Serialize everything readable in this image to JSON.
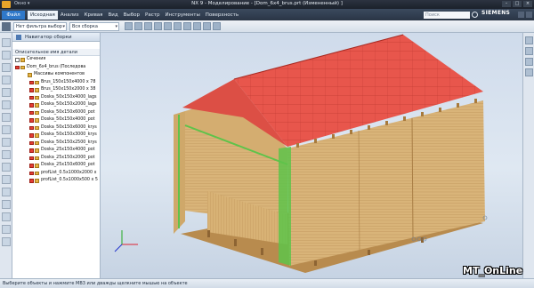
{
  "titlebar": {
    "title": "NX 9 - Моделирование - [Dom_6x4_brus.prt (Измененный) ]",
    "quick_access": "Окно ▾"
  },
  "ribbon": {
    "file_tab": "Файл",
    "tabs": [
      "Исходная",
      "Анализ",
      "Кривая",
      "Вид",
      "Выбор",
      "Растр",
      "Инструменты",
      "Поверхность"
    ],
    "active_tab": "Исходная",
    "search_placeholder": "Поиск",
    "brand": "SIEMENS"
  },
  "toolbar": {
    "filter_label": "Нет фильтра выбор",
    "scope_label": "Вся сборка"
  },
  "navigator": {
    "title": "Навигатор сборки",
    "column_header": "Описательное имя детали",
    "rows": [
      {
        "label": "Сечения",
        "indent": 1,
        "check": "empty"
      },
      {
        "label": "Dom_6x4_brus (Последова",
        "indent": 1,
        "check": "red"
      },
      {
        "label": "Массивы компонентов",
        "indent": 2,
        "check": "none"
      },
      {
        "label": "Brus_150x150x4000 x 78",
        "indent": 3,
        "check": "red"
      },
      {
        "label": "Brus_150x150x2000 x 38",
        "indent": 3,
        "check": "red"
      },
      {
        "label": "Doska_50x150x4000_lags",
        "indent": 3,
        "check": "red"
      },
      {
        "label": "Doska_50x150x2000_lags",
        "indent": 3,
        "check": "red"
      },
      {
        "label": "Doska_50x150x6000_pot",
        "indent": 3,
        "check": "red"
      },
      {
        "label": "Doska_50x150x4000_pot",
        "indent": 3,
        "check": "red"
      },
      {
        "label": "Doska_50x150x6000_krys",
        "indent": 3,
        "check": "red"
      },
      {
        "label": "Doska_50x150x3000_krys",
        "indent": 3,
        "check": "red"
      },
      {
        "label": "Doska_50x150x2500_krys",
        "indent": 3,
        "check": "red"
      },
      {
        "label": "Doska_25x150x4000_pot",
        "indent": 3,
        "check": "red"
      },
      {
        "label": "Doska_25x150x2000_pot",
        "indent": 3,
        "check": "red"
      },
      {
        "label": "Doska_25x150x6000_pot",
        "indent": 3,
        "check": "red"
      },
      {
        "label": "profList_0.5x1000x2000 x",
        "indent": 3,
        "check": "red"
      },
      {
        "label": "profList_0.5x1000x500 x 5",
        "indent": 3,
        "check": "red"
      }
    ]
  },
  "statusbar": {
    "message": "Выберите объекты и нажмите МВ3 или дважды щелкните мышью на объекте"
  },
  "watermark": "MT_OnLine",
  "colors": {
    "roof": "#e9574e",
    "wood": "#d7b074",
    "wood_dark": "#c39658",
    "highlight": "#5ec34a",
    "ribbon_bg": "#2f3b4b",
    "viewport_bg": "#d6e1ee"
  }
}
